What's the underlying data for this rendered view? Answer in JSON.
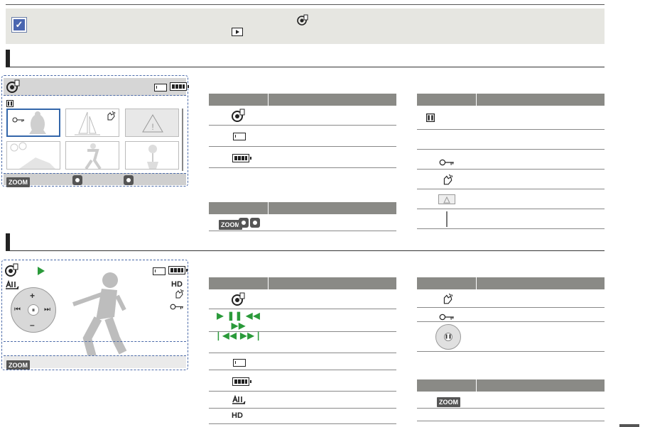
{
  "header": {
    "note_icon": "check-mark-icon"
  },
  "sections": [
    {
      "name": "thumbnail-view"
    },
    {
      "name": "single-view"
    }
  ],
  "thumbnail_screen": {
    "top_icons": [
      "playback-mode-icon",
      "memory-card-icon",
      "battery-icon"
    ],
    "info_icon": "video-info-icon",
    "thumbs": [
      "protected-image",
      "sailboat-image",
      "error-image",
      "picnic-image",
      "soccer-image",
      "flower-image"
    ],
    "bottom": {
      "zoom_label": "ZOOM",
      "buttons": [
        "multi-selector-button",
        "ok-button"
      ]
    }
  },
  "single_screen": {
    "top_icons": [
      "playback-mode-icon",
      "play-status-icon",
      "memory-card-icon",
      "battery-icon"
    ],
    "quality_label": "HD",
    "bottom": {
      "zoom_label": "ZOOM"
    },
    "joystick": [
      "plus-icon",
      "skip-back-icon",
      "pause-icon",
      "skip-forward-icon",
      "minus-icon"
    ]
  },
  "tables": {
    "thumb_left_rows": [
      "playback-mode-icon",
      "memory-card-icon",
      "battery-icon"
    ],
    "thumb_right_rows": [
      "video-info-icon",
      "",
      "protect-key-icon",
      "hand-touch-icon",
      "warning-icon",
      "scroll-bar-icon"
    ],
    "thumb_buttons_row": {
      "zoom_label": "ZOOM"
    },
    "single_left_rows": [
      "playback-mode-icon",
      "play-controls-icon",
      "",
      "memory-card-icon",
      "battery-icon",
      "all-icon",
      "hd-icon"
    ],
    "single_right_rows": [
      "hand-touch-icon",
      "protect-key-icon",
      "joystick-icon"
    ],
    "single_buttons_row": {
      "zoom_label": "ZOOM"
    }
  }
}
